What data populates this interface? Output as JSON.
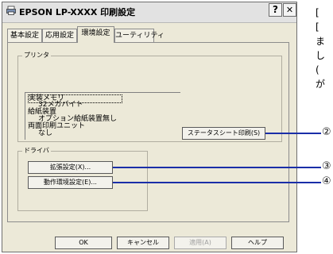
{
  "window": {
    "title": "EPSON LP-XXXX 印刷設定",
    "help_button": "?",
    "close_button": "✕"
  },
  "tabs": [
    {
      "label": "基本設定",
      "active": false
    },
    {
      "label": "応用設定",
      "active": false
    },
    {
      "label": "環境設定",
      "active": true
    },
    {
      "label": "ユーティリティ",
      "active": false
    }
  ],
  "printer_group": {
    "label": "プリンタ",
    "options_list": [
      "実装メモリ",
      "32メガバイト",
      "給紙装置",
      "オプション給紙装置無し",
      "両面印刷ユニット",
      "なし"
    ],
    "status_sheet_button": "ステータスシート印刷(S)"
  },
  "driver_group": {
    "label": "ドライバ",
    "extended_settings_button": "拡張設定(X)...",
    "environment_settings_button": "動作環境設定(E)..."
  },
  "footer": {
    "ok_button": "OK",
    "cancel_button": "キャンセル",
    "apply_button": "適用(A)",
    "help_button": "ヘルプ"
  },
  "callouts": [
    "②",
    "③",
    "④"
  ],
  "side_text": [
    "[",
    "[",
    "ま",
    "し",
    "(",
    "が"
  ]
}
